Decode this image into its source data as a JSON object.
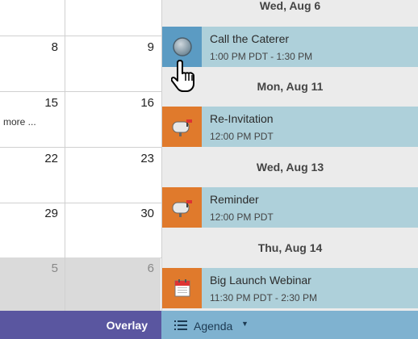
{
  "calendar": {
    "rows": [
      {
        "cells": [
          "",
          ""
        ]
      },
      {
        "cells": [
          "8",
          "9"
        ]
      },
      {
        "cells": [
          "15",
          "16"
        ],
        "more": "more ..."
      },
      {
        "cells": [
          "22",
          "23"
        ]
      },
      {
        "cells": [
          "29",
          "30"
        ]
      },
      {
        "cells": [
          "5",
          "6"
        ]
      }
    ]
  },
  "agenda": {
    "groups": [
      {
        "date": "Wed, Aug 6",
        "event": {
          "title": "Call the Caterer",
          "time": "1:00 PM PDT - 1:30 PM",
          "icon": "radio-circle-icon"
        }
      },
      {
        "date": "Mon, Aug 11",
        "event": {
          "title": "Re-Invitation",
          "time": "12:00 PM PDT",
          "icon": "mailbox-icon"
        }
      },
      {
        "date": "Wed, Aug 13",
        "event": {
          "title": "Reminder",
          "time": "12:00 PM PDT",
          "icon": "mailbox-icon"
        }
      },
      {
        "date": "Thu, Aug 14",
        "event": {
          "title": "Big Launch Webinar",
          "time": "11:30 PM PDT - 2:30 PM",
          "icon": "calendar-icon"
        }
      }
    ]
  },
  "bottom": {
    "overlay": "Overlay",
    "agenda": "Agenda"
  },
  "colors": {
    "overlay_bg": "#5a56a0",
    "agenda_tab_bg": "#7fb2d0",
    "event_bg": "#aed0da",
    "icon_orange": "#e07a2c",
    "icon_blue": "#5b9bc3"
  }
}
